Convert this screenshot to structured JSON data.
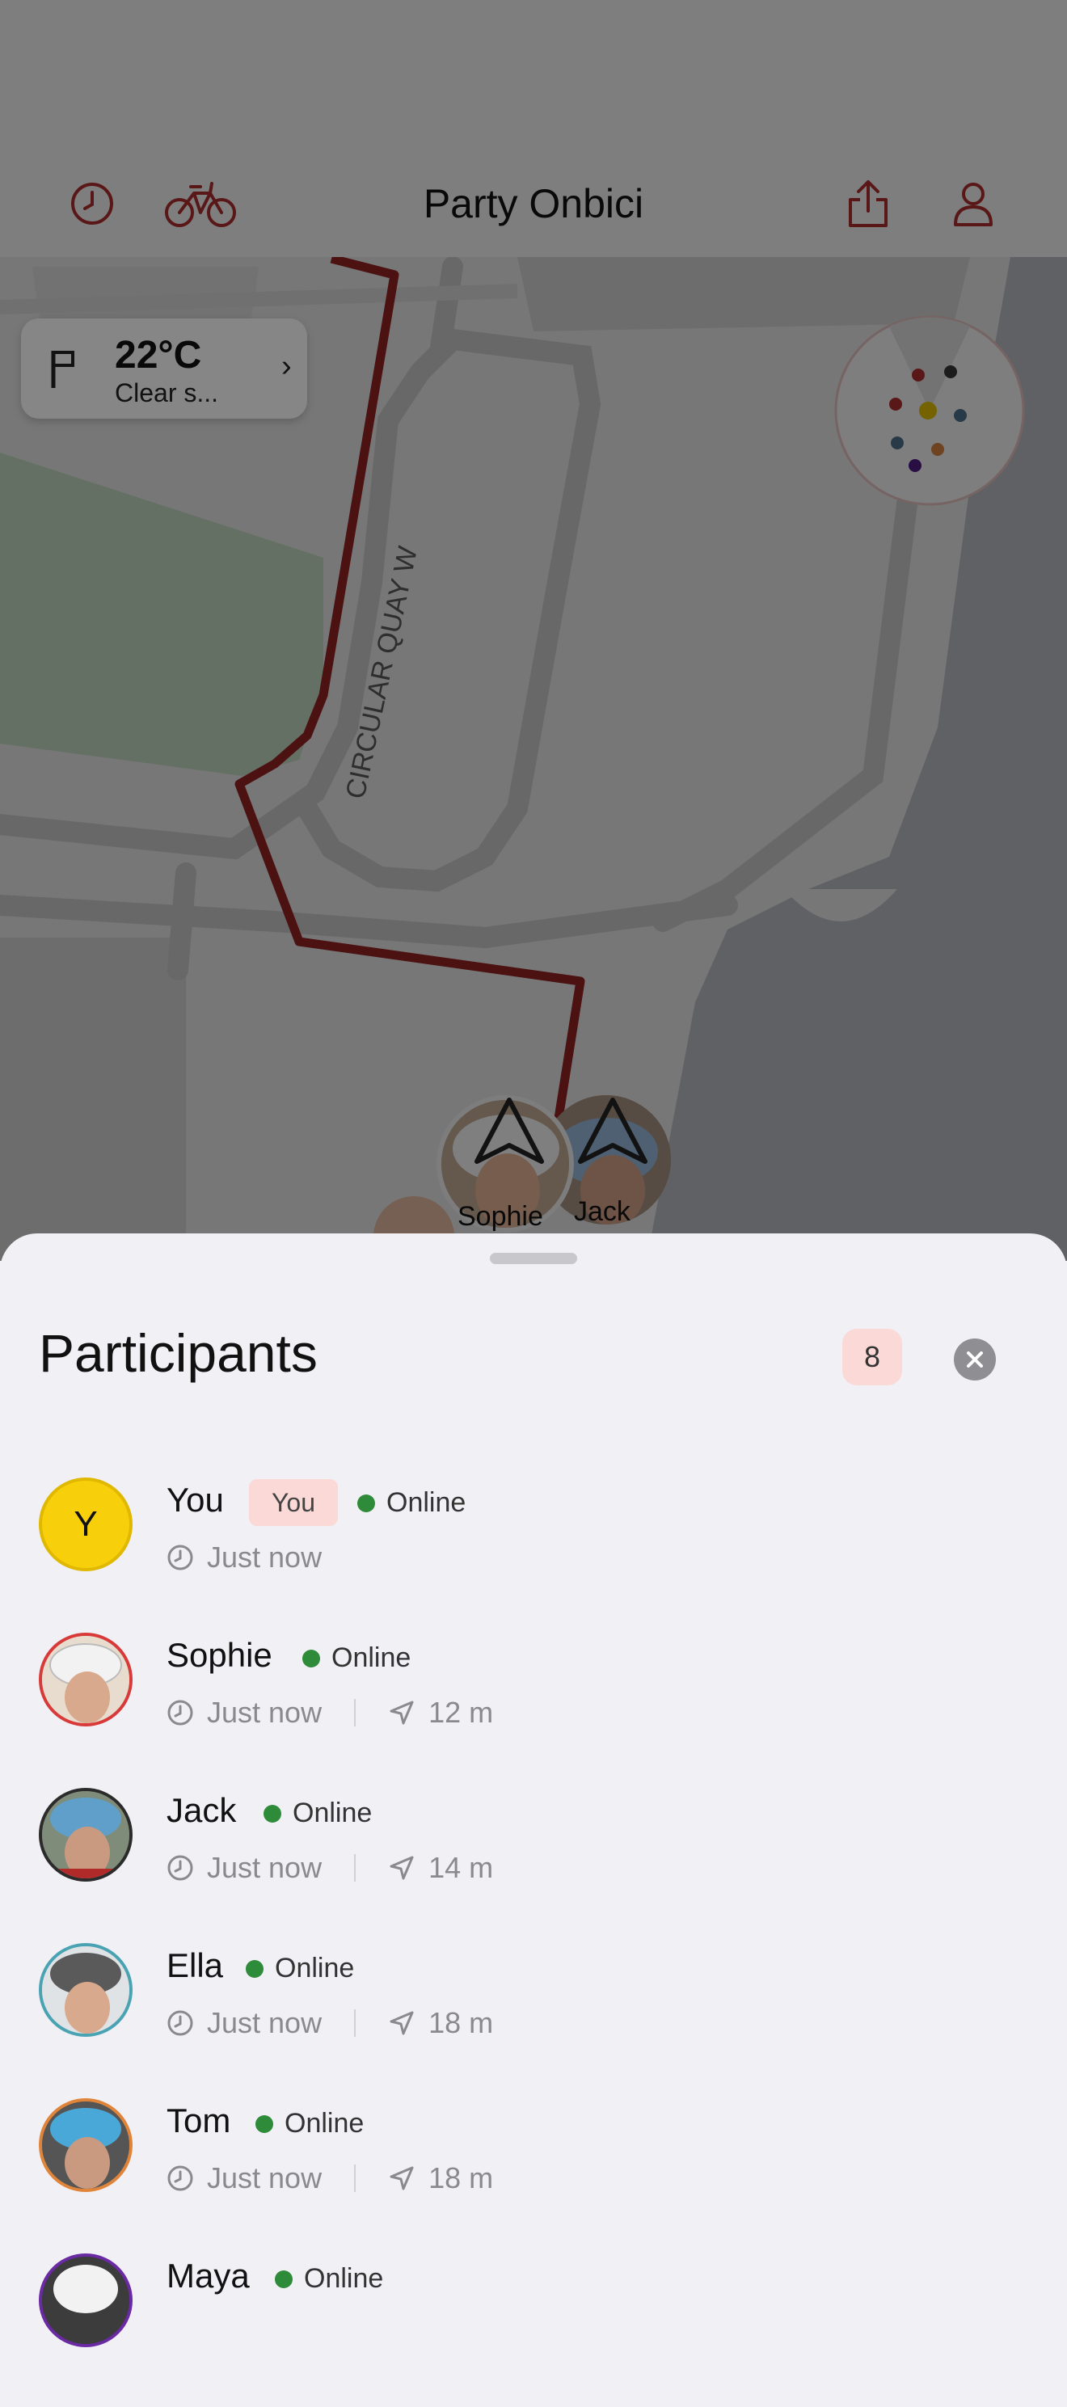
{
  "app": {
    "title": "Party Onbici",
    "history_icon": "clock-icon",
    "bike_icon": "bicycle-icon",
    "share_icon": "share-icon",
    "profile_icon": "person-icon",
    "accent": "#a32a2a"
  },
  "map": {
    "street_label": "CIRCULAR QUAY W",
    "route_color": "#8b1f1f",
    "markers": [
      {
        "name": "Sophie"
      },
      {
        "name": "Jack"
      }
    ]
  },
  "weather": {
    "temperature": "22°C",
    "condition": "Clear s...",
    "flag_icon": "flag-icon",
    "chevron_icon": "chevron-right-icon"
  },
  "minimap": {
    "dot_colors": [
      "#a32a2a",
      "#333333",
      "#a32a2a",
      "#d4b400",
      "#4a6a84",
      "#4a6a84",
      "#c87a3c",
      "#4a1a7a"
    ]
  },
  "participants": {
    "title": "Participants",
    "count": "8",
    "close_icon": "close-icon",
    "online_color": "#2e8b3a",
    "list": [
      {
        "name": "You",
        "initial": "Y",
        "self_badge": "You",
        "status": "Online",
        "last_seen": "Just now",
        "distance": ""
      },
      {
        "name": "Sophie",
        "status": "Online",
        "last_seen": "Just now",
        "distance": "12 m",
        "ring": "#d83a3a"
      },
      {
        "name": "Jack",
        "status": "Online",
        "last_seen": "Just now",
        "distance": "14 m",
        "ring": "#2b2b2b"
      },
      {
        "name": "Ella",
        "status": "Online",
        "last_seen": "Just now",
        "distance": "18 m",
        "ring": "#4aa3b3"
      },
      {
        "name": "Tom",
        "status": "Online",
        "last_seen": "Just now",
        "distance": "18 m",
        "ring": "#e0843a"
      },
      {
        "name": "Maya",
        "status": "Online",
        "last_seen": "",
        "distance": "",
        "ring": "#6a2aa3"
      }
    ]
  }
}
